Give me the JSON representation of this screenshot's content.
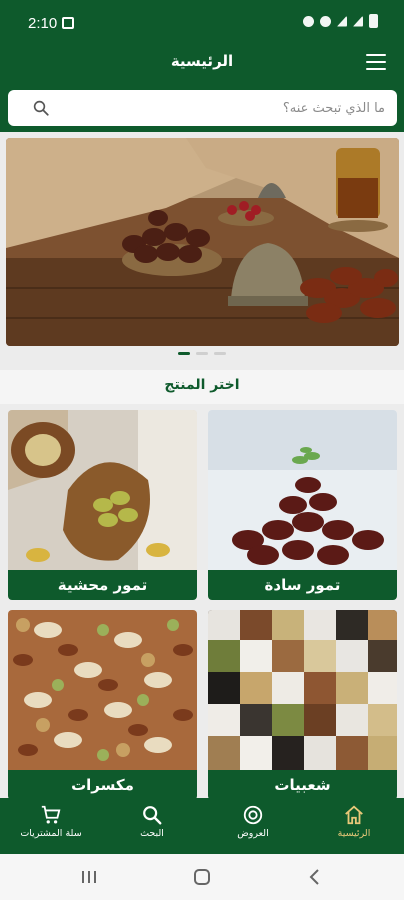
{
  "status_bar": {
    "time": "2:10"
  },
  "app_bar": {
    "title": "الرئيسية"
  },
  "search": {
    "placeholder": "ما الذي تبحث عنه؟"
  },
  "banner": {
    "pages": 3,
    "active_page": 1
  },
  "section": {
    "title": "اختر المنتج"
  },
  "categories": [
    {
      "label": "تمور سادة"
    },
    {
      "label": "تمور محشية"
    },
    {
      "label": "شعبيات"
    },
    {
      "label": "مكسرات"
    }
  ],
  "bottom_nav": [
    {
      "label": "الرئيسية",
      "icon": "home-icon",
      "active": true
    },
    {
      "label": "العروض",
      "icon": "offers-icon"
    },
    {
      "label": "البحث",
      "icon": "search-icon"
    },
    {
      "label": "سلة المشتريات",
      "icon": "cart-icon"
    }
  ],
  "colors": {
    "primary": "#0e5a2c",
    "active_nav": "#e8c879"
  }
}
